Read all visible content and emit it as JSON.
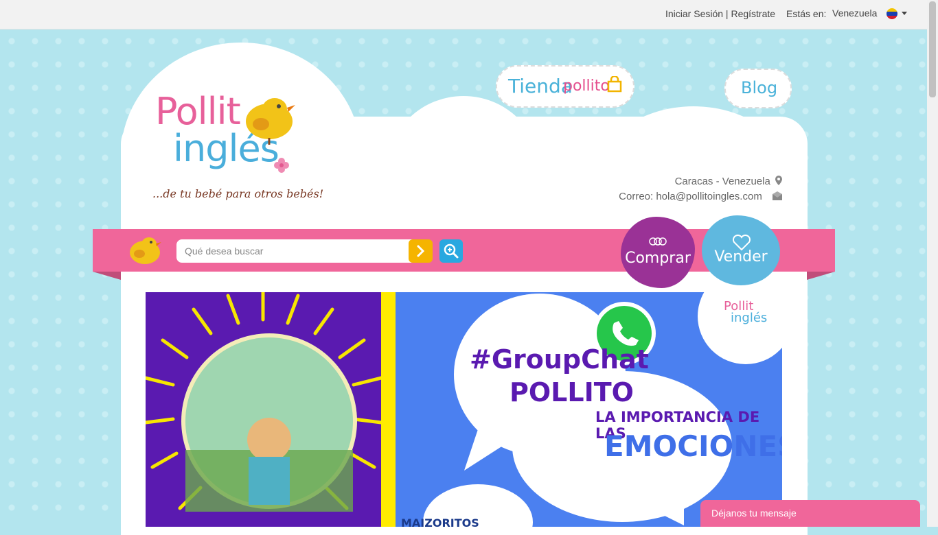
{
  "topbar": {
    "login": "Iniciar Sesión | Regístrate",
    "location_label": "Estás en:",
    "location_value": "Venezuela"
  },
  "logo": {
    "line1": "Pollit",
    "line2": "inglés",
    "tagline": "...de tu bebé para otros bebés!"
  },
  "nav": {
    "tienda_a": "Tienda",
    "tienda_b": "pollito",
    "blog": "Blog"
  },
  "contact": {
    "city": "Caracas - Venezuela",
    "email_label": "Correo: hola@pollitoingles.com"
  },
  "search": {
    "placeholder": "Qué desea buscar"
  },
  "actions": {
    "comprar": "Comprar",
    "vender": "Vender"
  },
  "banner": {
    "hashtag": "#GroupChat",
    "pollito": "POLLITO",
    "subtitle": "LA IMPORTANCIA DE LAS",
    "emociones": "EMOCIONES",
    "logo_line1": "Pollit",
    "logo_line2": "inglés",
    "brand": "MAIZORITOS"
  },
  "chat": {
    "label": "Déjanos tu mensaje"
  },
  "colors": {
    "pink": "#f0669a",
    "blue": "#4ab2d9",
    "purple": "#9a3296",
    "yellow": "#f5b400"
  }
}
